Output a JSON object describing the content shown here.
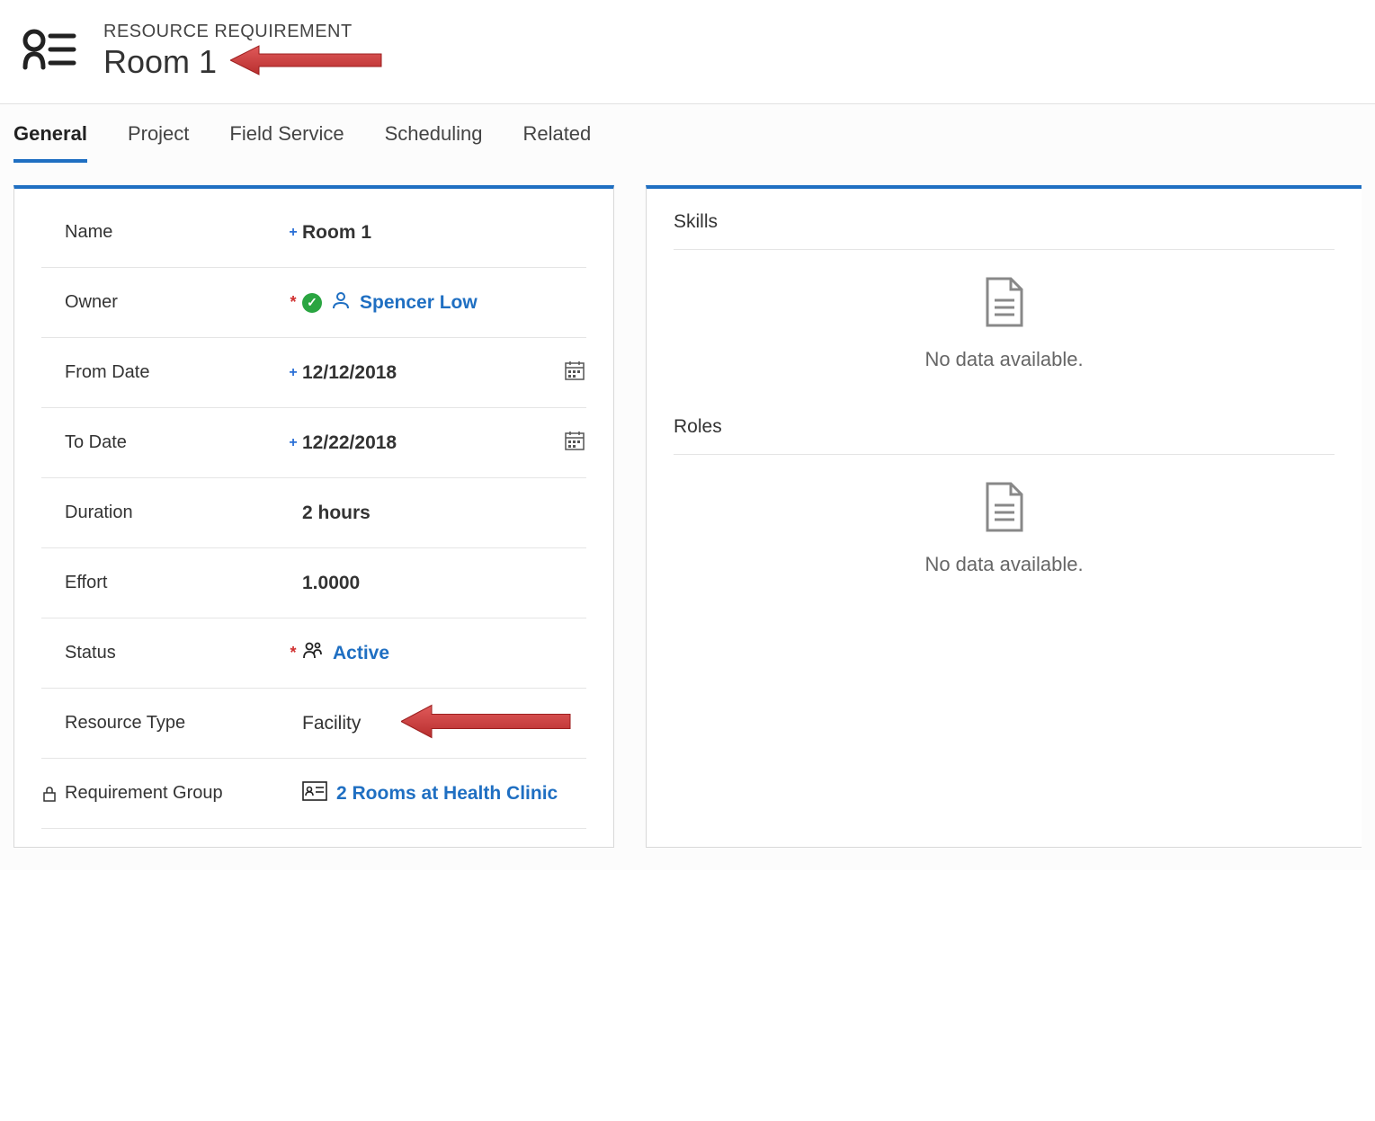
{
  "header": {
    "eyebrow": "RESOURCE REQUIREMENT",
    "title": "Room 1"
  },
  "tabs": [
    {
      "id": "general",
      "label": "General",
      "active": true
    },
    {
      "id": "project",
      "label": "Project",
      "active": false
    },
    {
      "id": "field-service",
      "label": "Field Service",
      "active": false
    },
    {
      "id": "scheduling",
      "label": "Scheduling",
      "active": false
    },
    {
      "id": "related",
      "label": "Related",
      "active": false
    }
  ],
  "fields": {
    "name": {
      "label": "Name",
      "value": "Room 1",
      "indicator": "+"
    },
    "owner": {
      "label": "Owner",
      "value": "Spencer Low",
      "indicator": "*"
    },
    "from_date": {
      "label": "From Date",
      "value": "12/12/2018",
      "indicator": "+"
    },
    "to_date": {
      "label": "To Date",
      "value": "12/22/2018",
      "indicator": "+"
    },
    "duration": {
      "label": "Duration",
      "value": "2 hours"
    },
    "effort": {
      "label": "Effort",
      "value": "1.0000"
    },
    "status": {
      "label": "Status",
      "value": "Active",
      "indicator": "*"
    },
    "resource_type": {
      "label": "Resource Type",
      "value": "Facility"
    },
    "requirement_group": {
      "label": "Requirement Group",
      "value": "2 Rooms at Health Clinic"
    }
  },
  "side": {
    "skills": {
      "title": "Skills",
      "empty_text": "No data available."
    },
    "roles": {
      "title": "Roles",
      "empty_text": "No data available."
    }
  }
}
